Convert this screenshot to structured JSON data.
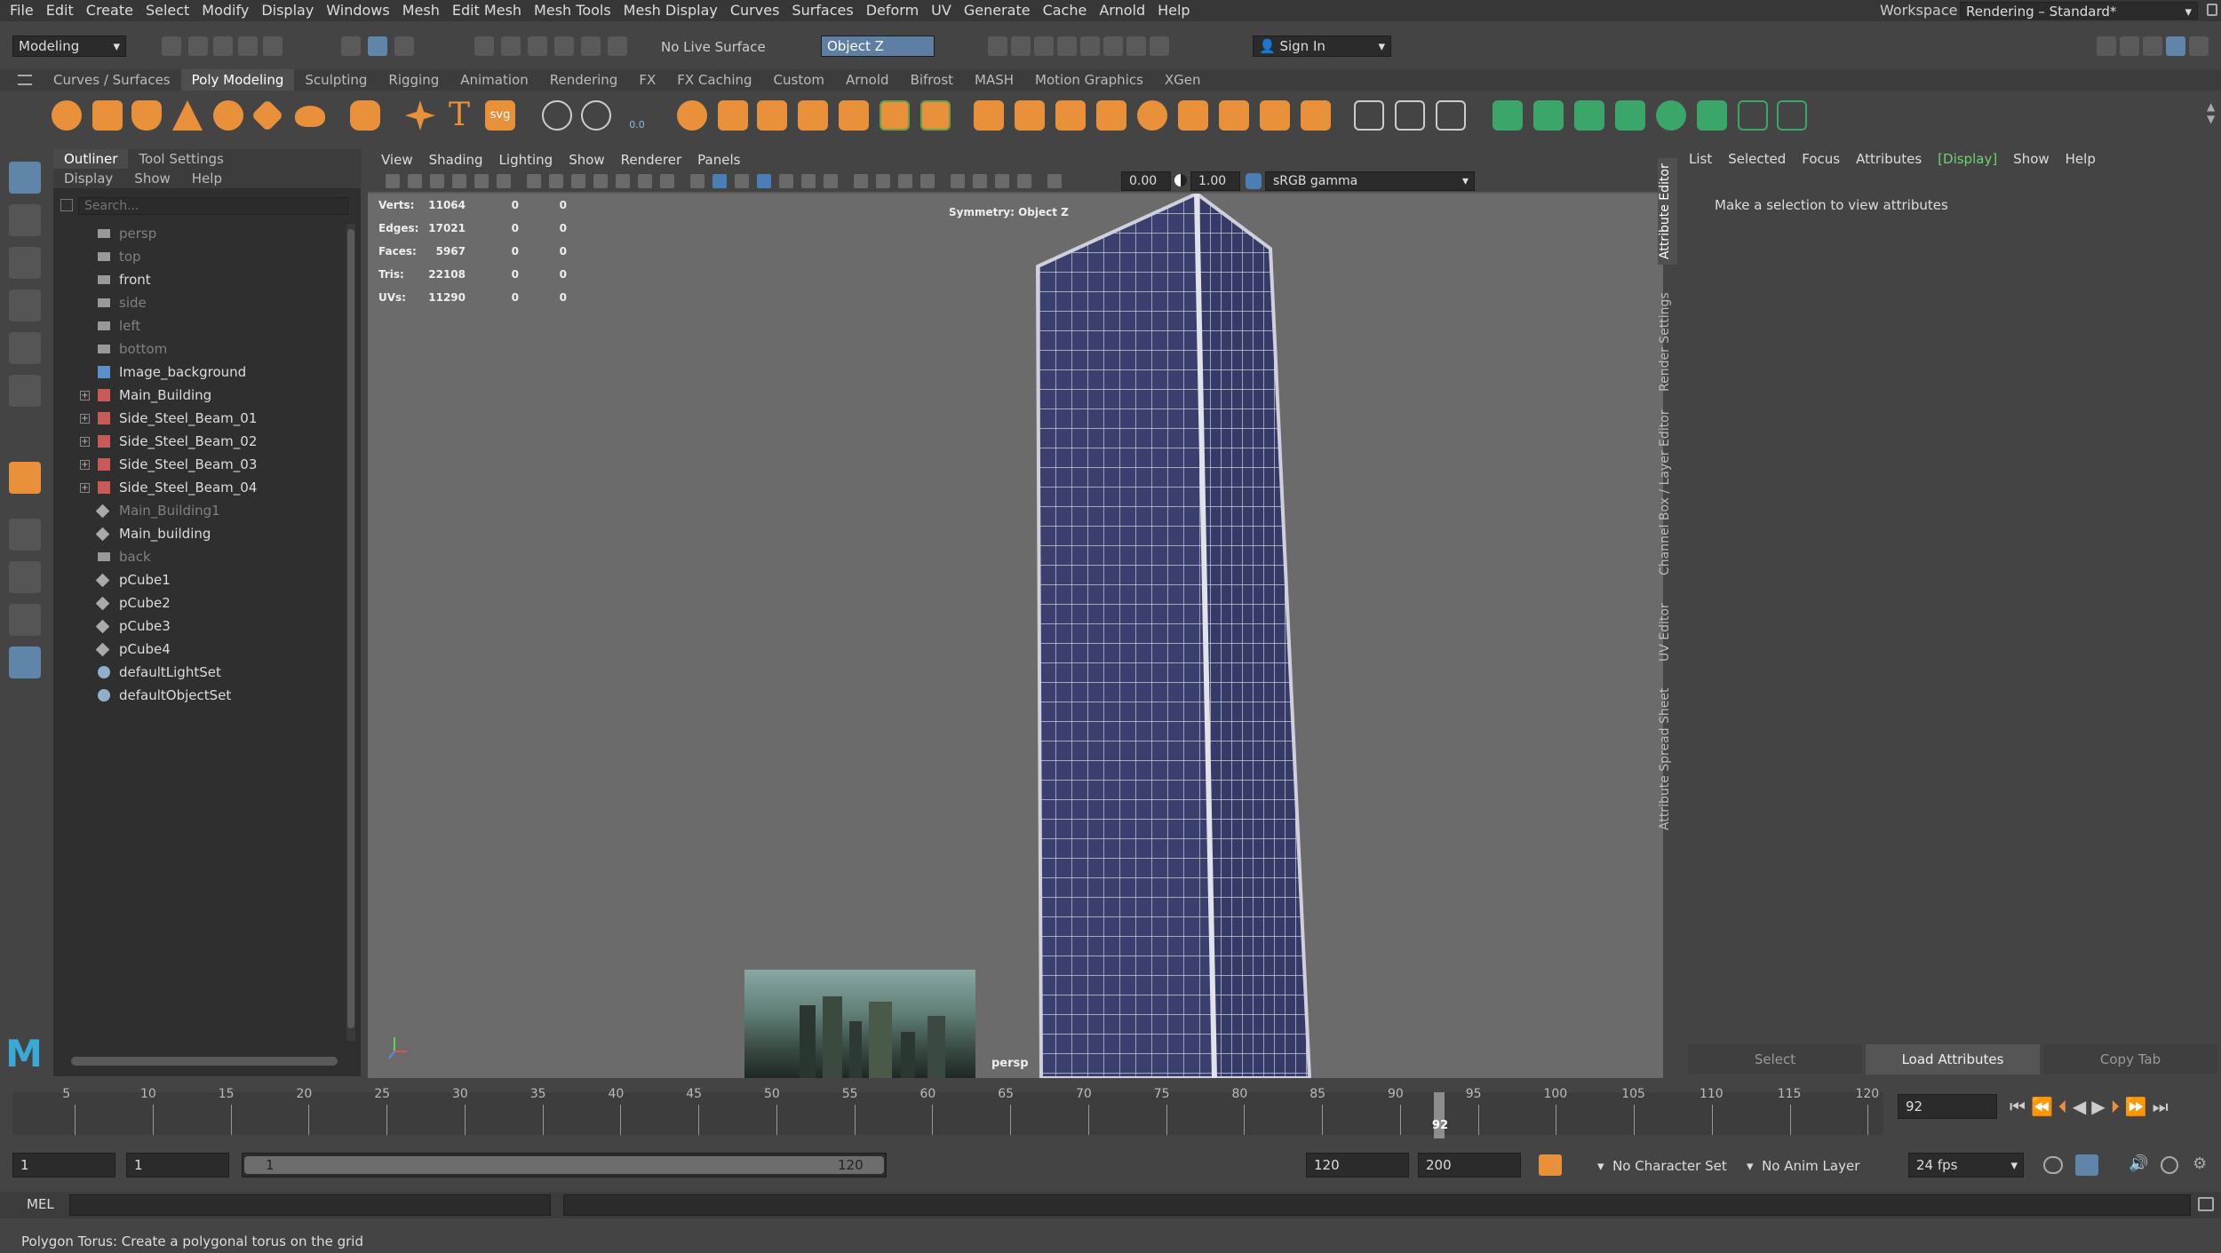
{
  "menubar": {
    "items": [
      "File",
      "Edit",
      "Create",
      "Select",
      "Modify",
      "Display",
      "Windows",
      "Mesh",
      "Edit Mesh",
      "Mesh Tools",
      "Mesh Display",
      "Curves",
      "Surfaces",
      "Deform",
      "UV",
      "Generate",
      "Cache",
      "Arnold",
      "Help"
    ],
    "workspace_label": "Workspace :",
    "workspace_value": "Rendering – Standard*"
  },
  "statusline": {
    "mode": "Modeling",
    "live_surface": "No Live Surface",
    "symmetry": "Object Z",
    "sign_in": "Sign In"
  },
  "shelf": {
    "tabs": [
      "Curves / Surfaces",
      "Poly Modeling",
      "Sculpting",
      "Rigging",
      "Animation",
      "Rendering",
      "FX",
      "FX Caching",
      "Custom",
      "Arnold",
      "Bifrost",
      "MASH",
      "Motion Graphics",
      "XGen"
    ],
    "active_tab": "Poly Modeling",
    "text_icon": "T",
    "svg_icon": "svg",
    "dist_icon": "0.0"
  },
  "outliner": {
    "tabs": [
      "Outliner",
      "Tool Settings"
    ],
    "menu": [
      "Display",
      "Show",
      "Help"
    ],
    "search_placeholder": "Search...",
    "items": [
      {
        "label": "persp",
        "icon": "camera-icon",
        "dim": true
      },
      {
        "label": "top",
        "icon": "camera-icon",
        "dim": true
      },
      {
        "label": "front",
        "icon": "camera-icon",
        "dim": false
      },
      {
        "label": "side",
        "icon": "camera-icon",
        "dim": true
      },
      {
        "label": "left",
        "icon": "camera-icon",
        "dim": true
      },
      {
        "label": "bottom",
        "icon": "camera-icon",
        "dim": true
      },
      {
        "label": "Image_background",
        "icon": "image-plane-icon",
        "dim": false
      },
      {
        "label": "Main_Building",
        "icon": "mesh-group-icon",
        "dim": false,
        "expand": true
      },
      {
        "label": "Side_Steel_Beam_01",
        "icon": "mesh-group-icon",
        "dim": false,
        "expand": true
      },
      {
        "label": "Side_Steel_Beam_02",
        "icon": "mesh-group-icon",
        "dim": false,
        "expand": true
      },
      {
        "label": "Side_Steel_Beam_03",
        "icon": "mesh-group-icon",
        "dim": false,
        "expand": true
      },
      {
        "label": "Side_Steel_Beam_04",
        "icon": "mesh-group-icon",
        "dim": false,
        "expand": true
      },
      {
        "label": "Main_Building1",
        "icon": "mesh-icon",
        "dim": true
      },
      {
        "label": "Main_building",
        "icon": "mesh-icon",
        "dim": false
      },
      {
        "label": "back",
        "icon": "camera-icon",
        "dim": true
      },
      {
        "label": "pCube1",
        "icon": "mesh-icon",
        "dim": false
      },
      {
        "label": "pCube2",
        "icon": "mesh-icon",
        "dim": false
      },
      {
        "label": "pCube3",
        "icon": "mesh-icon",
        "dim": false
      },
      {
        "label": "pCube4",
        "icon": "mesh-icon",
        "dim": false
      },
      {
        "label": "defaultLightSet",
        "icon": "set-icon",
        "dim": false
      },
      {
        "label": "defaultObjectSet",
        "icon": "set-icon",
        "dim": false
      }
    ]
  },
  "viewport": {
    "menu": [
      "View",
      "Shading",
      "Lighting",
      "Show",
      "Renderer",
      "Panels"
    ],
    "exposure": "0.00",
    "gamma": "1.00",
    "color_space": "sRGB gamma",
    "symmetry_hud": "Symmetry: Object Z",
    "camera_label": "persp",
    "stats": [
      {
        "label": "Verts:",
        "value": "11064",
        "sel": "0",
        "comp": "0"
      },
      {
        "label": "Edges:",
        "value": "17021",
        "sel": "0",
        "comp": "0"
      },
      {
        "label": "Faces:",
        "value": "5967",
        "sel": "0",
        "comp": "0"
      },
      {
        "label": "Tris:",
        "value": "22108",
        "sel": "0",
        "comp": "0"
      },
      {
        "label": "UVs:",
        "value": "11290",
        "sel": "0",
        "comp": "0"
      }
    ]
  },
  "attribute_editor": {
    "menu": [
      "List",
      "Selected",
      "Focus",
      "Attributes",
      "[Display]",
      "Show",
      "Help"
    ],
    "message": "Make a selection to view attributes",
    "buttons": [
      "Select",
      "Load Attributes",
      "Copy Tab"
    ],
    "side_tabs": [
      "Attribute Editor",
      "Render Settings",
      "Channel Box / Layer Editor",
      "UV Editor",
      "Attribute Spread Sheet"
    ]
  },
  "timeslider": {
    "labels": [
      "5",
      "10",
      "15",
      "20",
      "25",
      "30",
      "35",
      "40",
      "45",
      "50",
      "55",
      "60",
      "65",
      "70",
      "75",
      "80",
      "85",
      "90",
      "95",
      "100",
      "105",
      "110",
      "115",
      "120"
    ],
    "current_frame": "92",
    "current_frame_field": "92"
  },
  "range": {
    "start": "1",
    "anim_start": "1",
    "range_start": "1",
    "range_end": "120",
    "playback_end": "120",
    "anim_end": "200",
    "character_set": "No Character Set",
    "anim_layer": "No Anim Layer",
    "fps": "24 fps"
  },
  "cmdline": {
    "lang": "MEL"
  },
  "helpline": {
    "text": "Polygon Torus: Create a polygonal torus on the grid"
  }
}
